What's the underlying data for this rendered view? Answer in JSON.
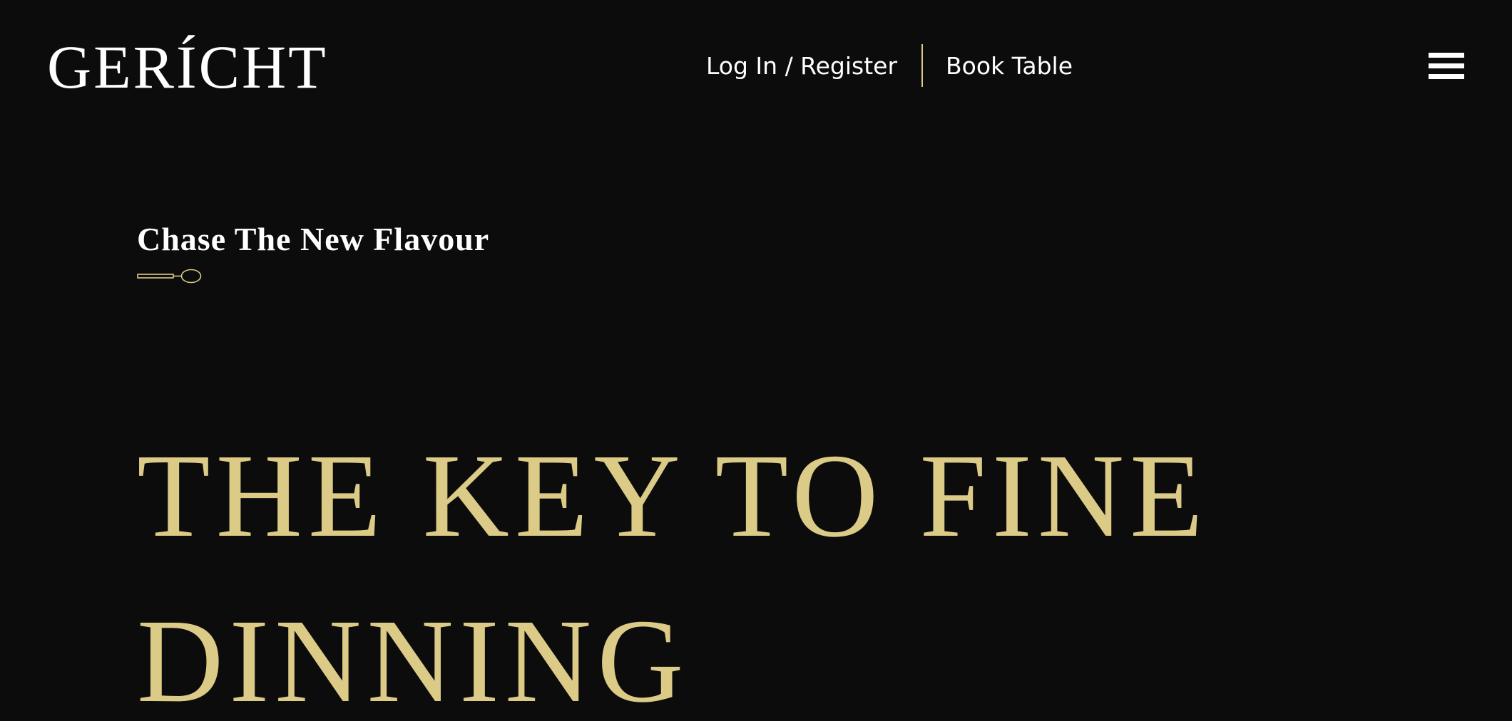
{
  "header": {
    "logo_text": "GERÍCHT",
    "nav": {
      "login_label": "Log In / Register",
      "book_label": "Book Table"
    },
    "menu_icon": "hamburger-menu-icon"
  },
  "hero": {
    "subtitle": "Chase The New Flavour",
    "decoration_icon": "spoon-icon",
    "headline": "THE KEY TO FINE DINNING"
  },
  "colors": {
    "background": "#0c0c0c",
    "accent_gold": "#dcca87",
    "text": "#ffffff"
  }
}
